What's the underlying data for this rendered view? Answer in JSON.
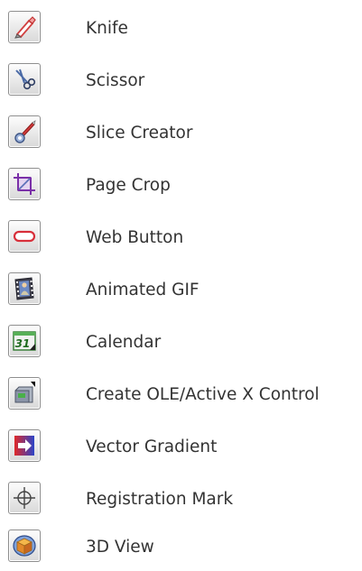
{
  "tools": [
    {
      "label": "Knife",
      "icon": "knife-icon"
    },
    {
      "label": "Scissor",
      "icon": "scissor-icon"
    },
    {
      "label": "Slice Creator",
      "icon": "slice-creator-icon"
    },
    {
      "label": "Page Crop",
      "icon": "page-crop-icon"
    },
    {
      "label": "Web Button",
      "icon": "web-button-icon"
    },
    {
      "label": "Animated GIF",
      "icon": "animated-gif-icon"
    },
    {
      "label": "Calendar",
      "icon": "calendar-icon",
      "glyph": "31"
    },
    {
      "label": "Create OLE/Active X Control",
      "icon": "ole-activex-icon"
    },
    {
      "label": "Vector Gradient",
      "icon": "vector-gradient-icon"
    },
    {
      "label": "Registration Mark",
      "icon": "registration-mark-icon"
    },
    {
      "label": "3D View",
      "icon": "3d-view-icon"
    }
  ]
}
